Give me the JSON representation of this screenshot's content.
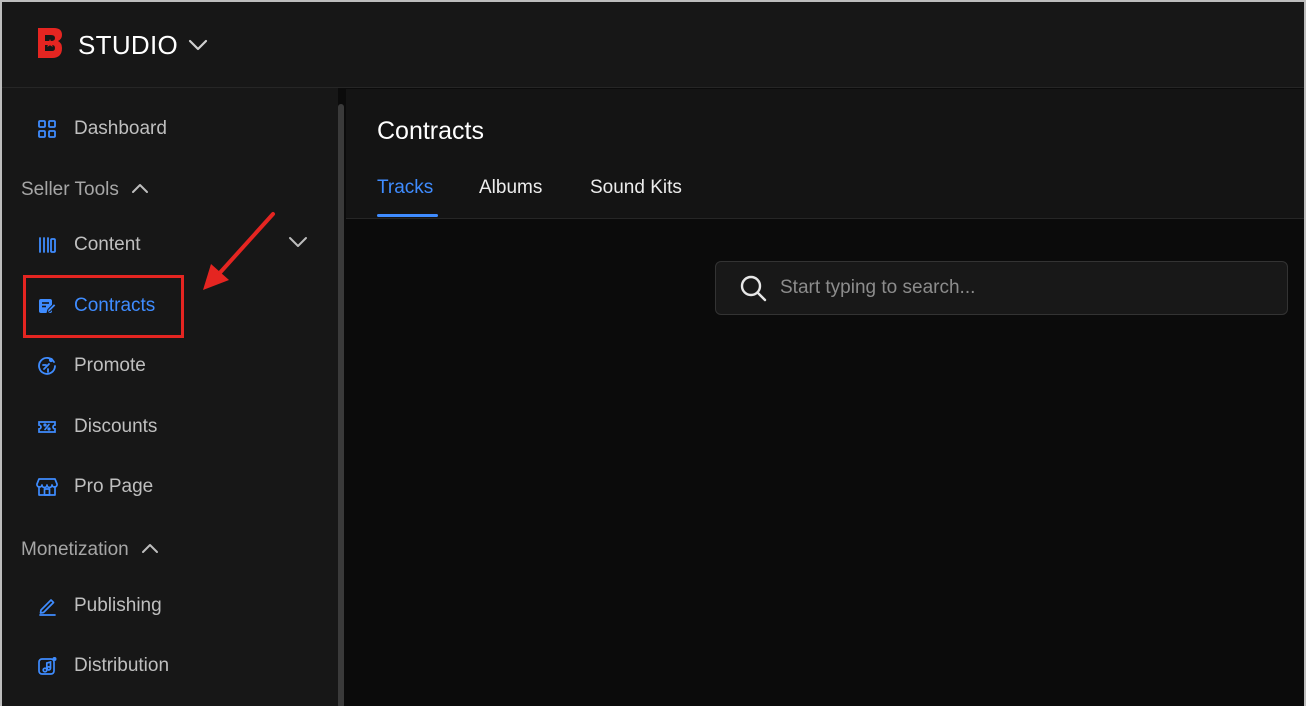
{
  "app": {
    "brand_name": "STUDIO",
    "accent_color": "#3f8cff",
    "brand_color": "#e52521"
  },
  "sidebar": {
    "dashboard": {
      "label": "Dashboard",
      "icon": "grid-icon"
    },
    "seller_tools": {
      "label": "Seller Tools",
      "items": [
        {
          "label": "Content",
          "icon": "library-icon"
        },
        {
          "label": "Contracts",
          "icon": "contract-edit-icon",
          "active": true
        },
        {
          "label": "Promote",
          "icon": "rocket-gauge-icon"
        },
        {
          "label": "Discounts",
          "icon": "discount-ticket-icon"
        },
        {
          "label": "Pro Page",
          "icon": "storefront-icon"
        }
      ]
    },
    "monetization": {
      "label": "Monetization",
      "items": [
        {
          "label": "Publishing",
          "icon": "pen-icon"
        },
        {
          "label": "Distribution",
          "icon": "music-note-icon"
        }
      ]
    }
  },
  "main": {
    "title": "Contracts",
    "tabs": [
      {
        "label": "Tracks",
        "active": true
      },
      {
        "label": "Albums"
      },
      {
        "label": "Sound Kits"
      }
    ],
    "search": {
      "placeholder": "Start typing to search...",
      "value": ""
    }
  }
}
